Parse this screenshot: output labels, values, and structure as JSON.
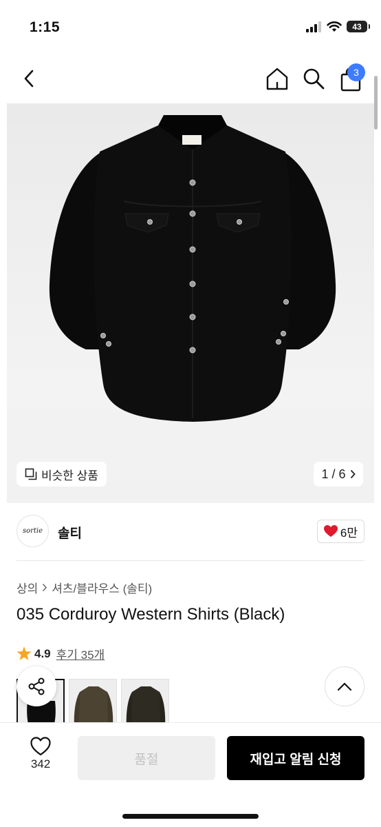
{
  "status_bar": {
    "time": "1:15",
    "battery": "43"
  },
  "nav": {
    "cart_count": "3"
  },
  "hero": {
    "similar_label": "비슷한 상품",
    "image_counter": "1 / 6"
  },
  "brand": {
    "logo_text": "sortie",
    "name": "솔티",
    "like_count": "6만"
  },
  "product": {
    "breadcrumb": [
      "상의",
      "셔츠/블라우스 (솔티)"
    ],
    "title": "035 Corduroy Western Shirts (Black)",
    "rating": "4.9",
    "review_link": "후기 35개",
    "thumbnail_colors": [
      "#111111",
      "#4c4332",
      "#2e2b22"
    ]
  },
  "bottom_bar": {
    "wish_count": "342",
    "sold_out_label": "품절",
    "restock_label": "재입고 알림 신청"
  },
  "colors": {
    "accent": "#3d7bff",
    "like": "#e0192d",
    "star": "#f5a623"
  }
}
